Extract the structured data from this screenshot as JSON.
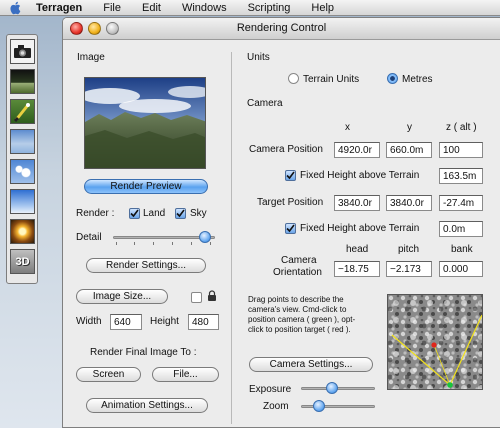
{
  "menubar": {
    "app": "Terragen",
    "items": [
      "File",
      "Edit",
      "Windows",
      "Scripting",
      "Help"
    ]
  },
  "palette": {
    "tools": [
      "camera-tool",
      "landscape-tool",
      "paint-tool",
      "sky-tool",
      "clouds-tool",
      "atmosphere-tool",
      "sun-tool",
      "3d-preview-tool"
    ],
    "label_3d": "3D"
  },
  "window": {
    "title": "Rendering Control"
  },
  "image": {
    "header": "Image",
    "render_preview": "Render Preview",
    "render_label": "Render :",
    "land_label": "Land",
    "land_checked": true,
    "sky_label": "Sky",
    "sky_checked": true,
    "detail_label": "Detail",
    "detail_level": 0.95,
    "render_settings": "Render Settings...",
    "image_size": "Image Size...",
    "aspect_locked": false,
    "width_label": "Width",
    "width_value": "640",
    "height_label": "Height",
    "height_value": "480",
    "final_label": "Render Final Image To :",
    "screen": "Screen",
    "file": "File...",
    "animation_settings": "Animation Settings..."
  },
  "units": {
    "header": "Units",
    "terrain_units": "Terrain Units",
    "metres": "Metres",
    "selected": "metres"
  },
  "camera": {
    "header": "Camera",
    "col_x": "x",
    "col_y": "y",
    "col_z": "z ( alt )",
    "camera_position_label": "Camera Position",
    "cam_x": "4920.0r",
    "cam_y": "660.0m",
    "cam_z": "100",
    "fixed_height_label": "Fixed Height above Terrain",
    "cam_fixed_checked": true,
    "cam_fixed_value": "163.5m",
    "target_position_label": "Target Position",
    "tgt_x": "3840.0r",
    "tgt_y": "3840.0r",
    "tgt_z": "-27.4m",
    "tgt_fixed_checked": true,
    "tgt_fixed_value": "0.0m",
    "col_head": "head",
    "col_pitch": "pitch",
    "col_bank": "bank",
    "orientation_label_1": "Camera",
    "orientation_label_2": "Orientation",
    "head": "−18.75",
    "pitch": "−2.173",
    "bank": "0.000",
    "help_1": "Drag points to describe the",
    "help_2": "camera's view. Cmd-click to",
    "help_3": "position camera ( green ), opt-",
    "help_4": "click to position target ( red ).",
    "camera_settings": "Camera Settings...",
    "exposure_label": "Exposure",
    "exposure_level": 0.4,
    "zoom_label": "Zoom",
    "zoom_level": 0.2
  },
  "colors": {
    "accent": "#5aa2ef",
    "camera_marker": "#19c43a",
    "target_marker": "#e0261b",
    "view_lines": "#f2e21a"
  }
}
